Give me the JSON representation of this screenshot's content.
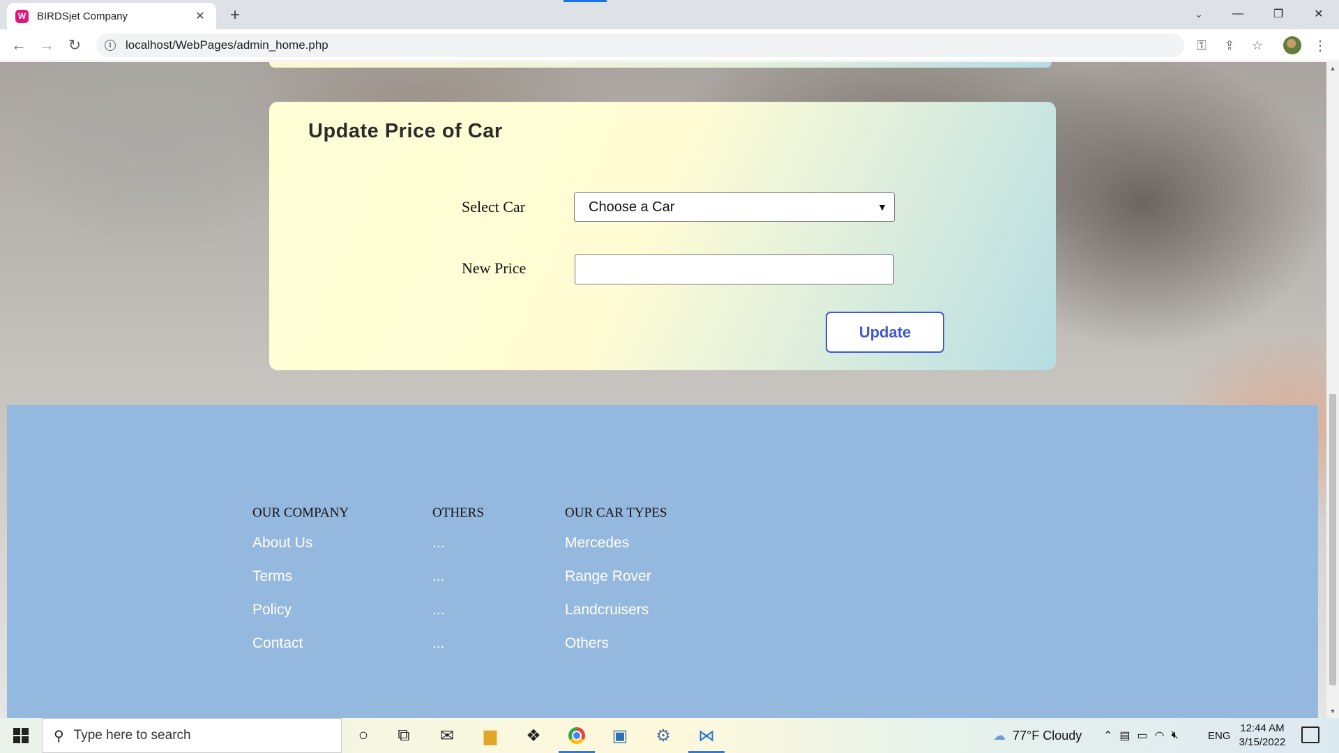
{
  "browser": {
    "tab_title": "BIRDSjet Company",
    "tab_favicon": "W",
    "url": "localhost/WebPages/admin_home.php"
  },
  "form": {
    "title": "Update Price of Car",
    "select_label": "Select Car",
    "select_value": "Choose a Car",
    "price_label": "New Price",
    "price_value": "",
    "button_label": "Update"
  },
  "footer": {
    "columns": [
      {
        "heading": "OUR COMPANY",
        "links": [
          "About Us",
          "Terms",
          "Policy",
          "Contact"
        ]
      },
      {
        "heading": "OTHERS",
        "links": [
          "...",
          "...",
          "...",
          "..."
        ]
      },
      {
        "heading": "OUR CAR TYPES",
        "links": [
          "Mercedes",
          "Range Rover",
          "Landcruisers",
          "Others"
        ]
      }
    ]
  },
  "taskbar": {
    "search_placeholder": "Type here to search",
    "weather": "77°F  Cloudy",
    "language": "ENG",
    "time": "12:44 AM",
    "date": "3/15/2022"
  },
  "colors": {
    "accent_button": "#3b57d8",
    "footer_bg": "#95b8df",
    "favicon": "#e0177a"
  }
}
